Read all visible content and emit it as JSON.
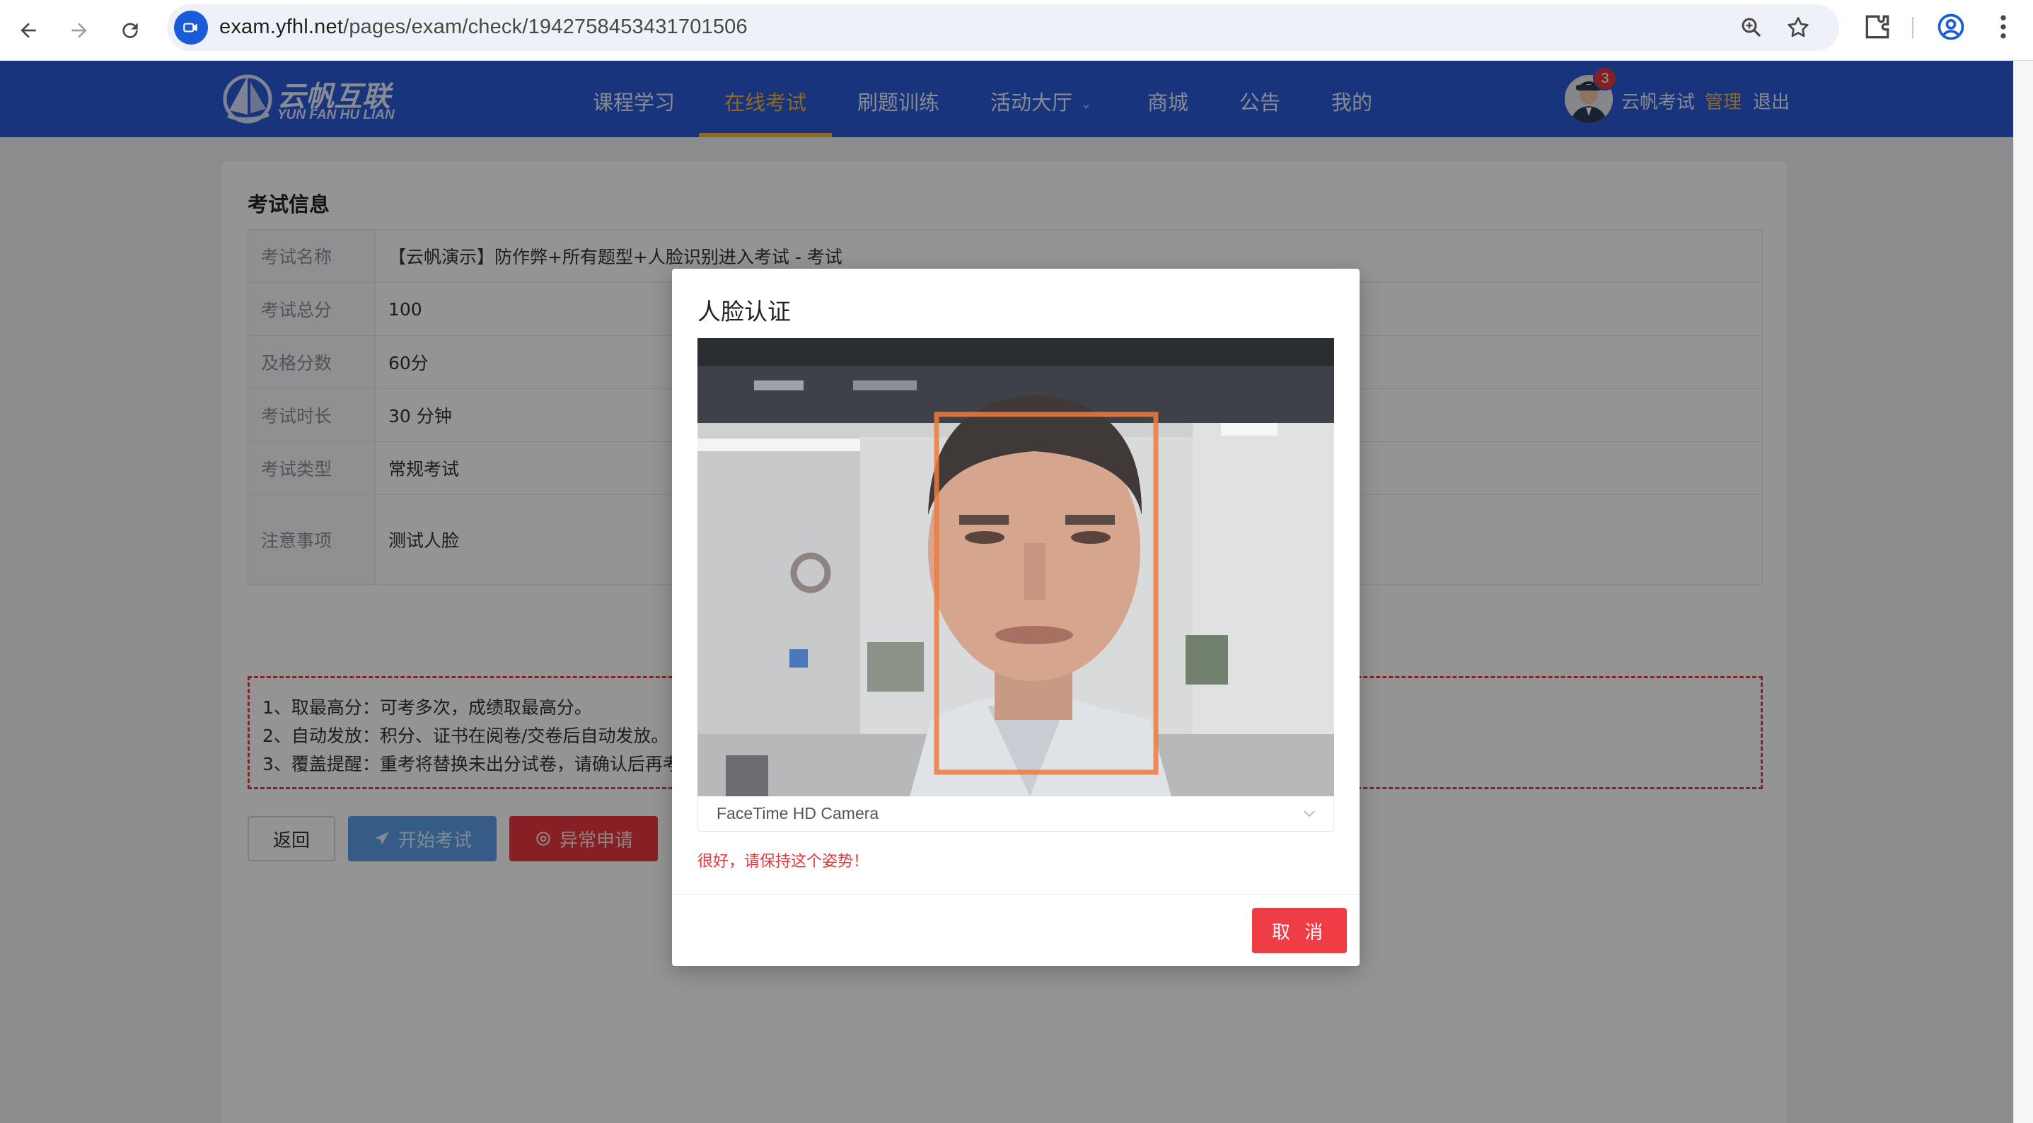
{
  "browser": {
    "url_host": "exam.yfhl.net",
    "url_path": "/pages/exam/check/1942758453431701506"
  },
  "header": {
    "logo_cn": "云帆互联",
    "logo_en": "YUN FAN HU LIAN",
    "nav": [
      {
        "label": "课程学习",
        "active": false
      },
      {
        "label": "在线考试",
        "active": true
      },
      {
        "label": "刷题训练",
        "active": false
      },
      {
        "label": "活动大厅",
        "active": false,
        "dropdown": true
      },
      {
        "label": "商城",
        "active": false
      },
      {
        "label": "公告",
        "active": false
      },
      {
        "label": "我的",
        "active": false
      }
    ],
    "user": {
      "badge_count": "3",
      "name": "云帆考试",
      "admin_label": "管理",
      "logout_label": "退出"
    }
  },
  "exam_info": {
    "title": "考试信息",
    "rows": [
      {
        "label": "考试名称",
        "value": "【云帆演示】防作弊+所有题型+人脸识别进入考试 - 考试"
      },
      {
        "label": "考试总分",
        "value": "100"
      },
      {
        "label": "及格分数",
        "value": "60分"
      },
      {
        "label": "考试时长",
        "value": "30 分钟"
      },
      {
        "label": "考试类型",
        "value": "常规考试"
      },
      {
        "label": "注意事项",
        "value": "测试人脸"
      }
    ],
    "notices": [
      "1、取最高分：可考多次，成绩取最高分。",
      "2、自动发放：积分、证书在阅卷/交卷后自动发放。",
      "3、覆盖提醒：重考将替换未出分试卷，请确认后再考"
    ],
    "buttons": {
      "back": "返回",
      "start": "开始考试",
      "exception": "异常申请"
    }
  },
  "modal": {
    "title": "人脸认证",
    "camera_name": "FaceTime HD Camera",
    "message": "很好，请保持这个姿势！",
    "cancel": "取 消"
  },
  "colors": {
    "header_blue": "#2a5ad6",
    "nav_active": "#f5b63c",
    "danger_red": "#e8383e",
    "start_blue": "#5a9fe8"
  }
}
